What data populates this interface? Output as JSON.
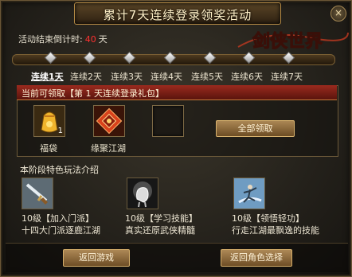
{
  "title": "累计7天连续登录领奖活动",
  "close_label": "×",
  "countdown": {
    "label": "活动结束倒计时:",
    "value": "40",
    "unit": "天"
  },
  "logo_text": "剑侠世界",
  "days": [
    "连续1天",
    "连续2天",
    "连续3天",
    "连续4天",
    "连续5天",
    "连续6天",
    "连续7天"
  ],
  "current_pack": {
    "label": "当前可领取【第 1 天连续登录礼包】"
  },
  "rewards": [
    {
      "name": "福袋",
      "count": "1",
      "icon": "lucky-bag-icon"
    },
    {
      "name": "缘聚江湖",
      "count": "",
      "icon": "fate-token-icon"
    },
    {
      "name": "",
      "count": "",
      "icon": "empty-slot"
    }
  ],
  "claim_all": "全部领取",
  "features_title": "本阶段特色玩法介绍",
  "features": [
    {
      "line1": "10级【加入门派】",
      "line2": "十四大门派逐鹿江湖",
      "icon": "sword-icon"
    },
    {
      "line1": "10级【学习技能】",
      "line2": "真实还原武侠精髓",
      "icon": "fist-skill-icon"
    },
    {
      "line1": "10级【领悟轻功】",
      "line2": "行走江湖最飘逸的技能",
      "icon": "flying-hero-icon"
    }
  ],
  "buttons": {
    "return_game": "返回游戏",
    "return_select": "返回角色选择"
  },
  "colors": {
    "accent": "#b48a45",
    "countdown_number": "#ff3030",
    "header_red": "#9b2a1e"
  }
}
